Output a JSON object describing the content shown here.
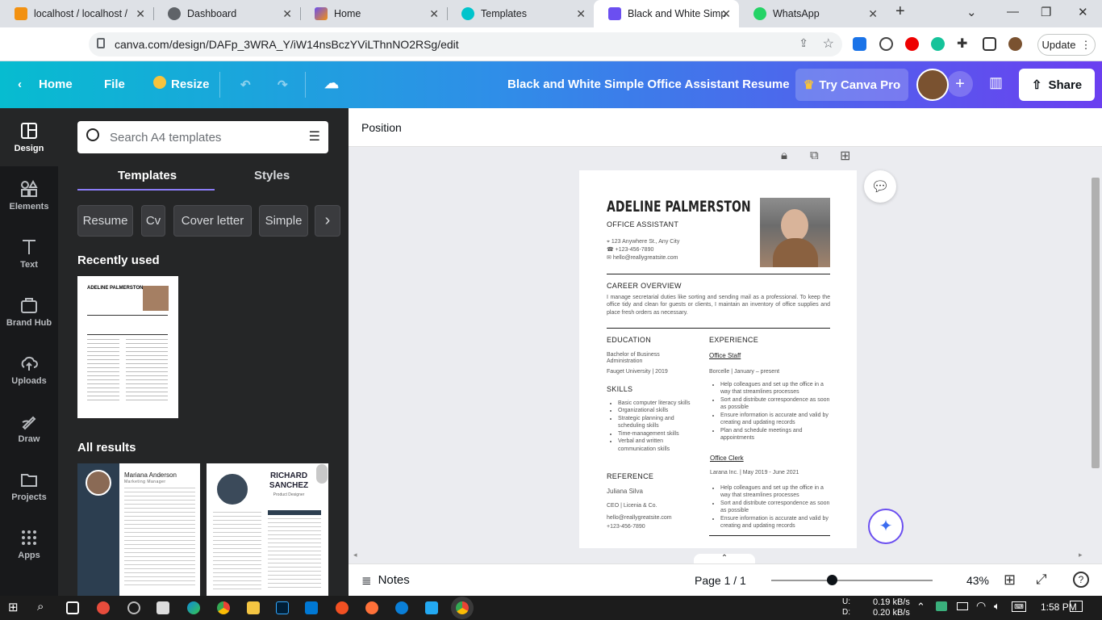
{
  "browser": {
    "tabs": [
      {
        "title": "localhost / localhost /",
        "color": "#f29111"
      },
      {
        "title": "Dashboard",
        "color": "#5f6368"
      },
      {
        "title": "Home",
        "color": "#6b4ff0"
      },
      {
        "title": "Templates",
        "color": "#00c4cc"
      },
      {
        "title": "Black and White Simp",
        "color": "#6b4ff0"
      },
      {
        "title": "WhatsApp",
        "color": "#25d366"
      }
    ],
    "url": "canva.com/design/DAFp_3WRA_Y/iW14nsBczYViLThnNO2RSg/edit",
    "update_label": "Update"
  },
  "topbar": {
    "home": "Home",
    "file": "File",
    "resize": "Resize",
    "design_title": "Black and White Simple Office Assistant Resume",
    "try_pro": "Try Canva Pro",
    "share": "Share"
  },
  "rail": [
    {
      "label": "Design",
      "icon": "layout-icon"
    },
    {
      "label": "Elements",
      "icon": "shapes-icon"
    },
    {
      "label": "Text",
      "icon": "text-icon"
    },
    {
      "label": "Brand Hub",
      "icon": "brand-icon"
    },
    {
      "label": "Uploads",
      "icon": "upload-cloud-icon"
    },
    {
      "label": "Draw",
      "icon": "draw-icon"
    },
    {
      "label": "Projects",
      "icon": "folder-icon"
    },
    {
      "label": "Apps",
      "icon": "apps-grid-icon"
    }
  ],
  "panel": {
    "search_placeholder": "Search A4 templates",
    "tabs": [
      "Templates",
      "Styles"
    ],
    "chips": [
      "Resume",
      "Cv",
      "Cover letter",
      "Simple"
    ],
    "recent_heading": "Recently used",
    "all_heading": "All results",
    "thumb_names": [
      "Mariana Anderson",
      "RICHARD SANCHEZ"
    ],
    "thumb_roles": [
      "Marketing Manager",
      "Product Designer"
    ]
  },
  "context_bar": {
    "position": "Position"
  },
  "resume": {
    "name": "ADELINE PALMERSTON",
    "role": "OFFICE ASSISTANT",
    "address": "123 Anywhere St., Any City",
    "phone": "+123-456-7890",
    "email": "hello@reallygreatsite.com",
    "overview_heading": "CAREER OVERVIEW",
    "overview_text": "I manage secretarial duties like sorting and sending mail as a professional. To keep the office tidy and clean for guests or clients, I maintain an inventory of office supplies and place fresh orders as necessary.",
    "education_heading": "EDUCATION",
    "degree": "Bachelor of Business Administration",
    "school": "Fauget University | 2019",
    "skills_heading": "SKILLS",
    "skills": [
      "Basic computer literacy skills",
      "Organizational skills",
      "Strategic planning and scheduling skills",
      "Time-management skills",
      "Verbal and written communication skills"
    ],
    "reference_heading": "REFERENCE",
    "ref_name": "Juliana Silva",
    "ref_title": "CEO | Licenia & Co.",
    "ref_email": "hello@reallygreatsite.com",
    "ref_phone": "+123-456-7890",
    "experience_heading": "EXPERIENCE",
    "job1_title": "Office Staff",
    "job1_meta": "Borcelle | January – present",
    "job1_bullets": [
      "Help colleagues and set up the office in a way that streamlines processes",
      "Sort and distribute correspondence as soon as possible",
      "Ensure information is accurate and valid by creating and updating records",
      "Plan and schedule meetings and appointments"
    ],
    "job2_title": "Office Clerk",
    "job2_meta": "Larana Inc. | May 2019 - June 2021",
    "job2_bullets": [
      "Help colleagues and set up the office in a way that streamlines processes",
      "Sort and distribute correspondence as soon as possible",
      "Ensure information is accurate and valid by creating and updating records"
    ]
  },
  "bottombar": {
    "notes": "Notes",
    "page": "Page 1 / 1",
    "zoom": "43%",
    "zoom_value": 0.43
  },
  "taskbar": {
    "upload_label": "U:",
    "download_label": "D:",
    "upload": "0.19 kB/s",
    "download": "0.20 kB/s",
    "time": "1:58 PM"
  }
}
